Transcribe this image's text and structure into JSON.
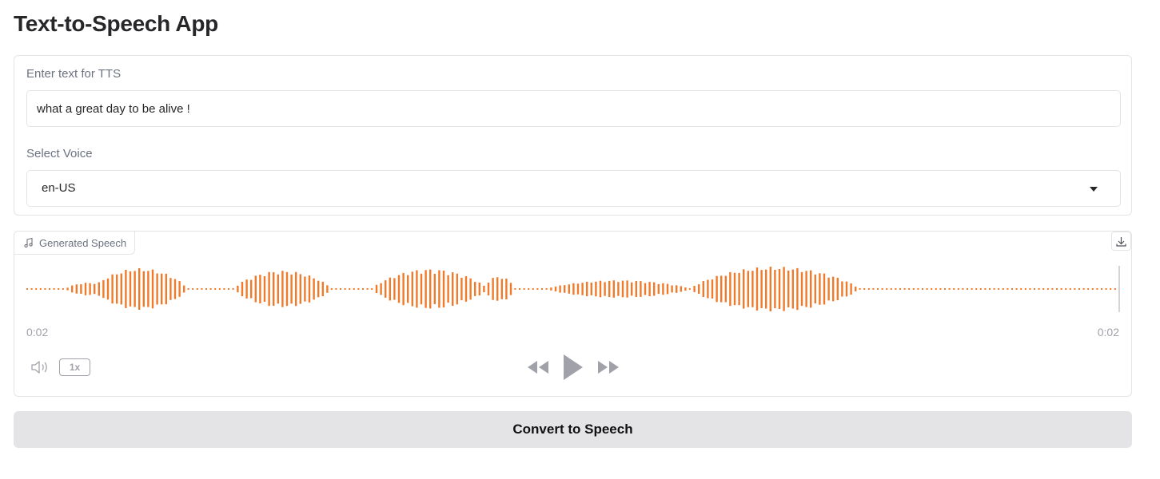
{
  "app": {
    "title": "Text-to-Speech App"
  },
  "text_input": {
    "label": "Enter text for TTS",
    "value": "what a great day to be alive !"
  },
  "voice_select": {
    "label": "Select Voice",
    "selected": "en-US"
  },
  "audio": {
    "label": "Generated Speech",
    "current_time": "0:02",
    "duration": "0:02",
    "playback_rate": "1x",
    "waveform_color": "#f07a2a",
    "icons": {
      "label": "music-note-icon",
      "download": "download-icon",
      "volume": "volume-icon",
      "rewind": "rewind-icon",
      "play": "play-icon",
      "forward": "fast-forward-icon"
    }
  },
  "actions": {
    "convert_label": "Convert to Speech"
  },
  "colors": {
    "accent": "#f07a2a",
    "border": "#e4e4e7",
    "button_bg": "#e4e4e7",
    "muted_text": "#6b7280"
  }
}
